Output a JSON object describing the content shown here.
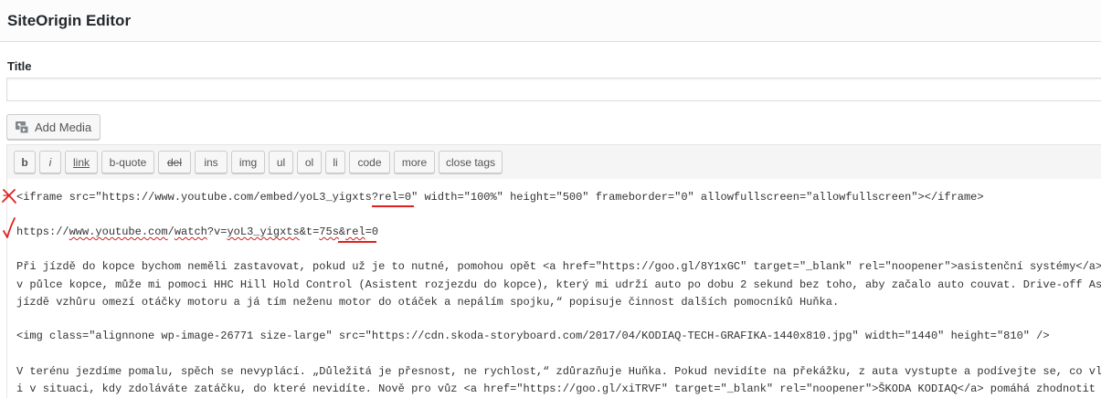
{
  "header": {
    "title": "SiteOrigin Editor"
  },
  "title_field": {
    "label": "Title",
    "value": ""
  },
  "media": {
    "label": "Add Media",
    "icon": "add-media-icon"
  },
  "toolbar": {
    "buttons": [
      "b",
      "i",
      "link",
      "b-quote",
      "del",
      "ins",
      "img",
      "ul",
      "ol",
      "li",
      "code",
      "more",
      "close tags"
    ]
  },
  "annotations": {
    "wrong_mark": "✗",
    "correct_mark": "✓",
    "mark_color": "#e02020"
  },
  "content": {
    "line1": "<iframe src=\"https://www.youtube.com/embed/yoL3_yigxts?rel=0\" width=\"100%\" height=\"500\" frameborder=\"0\" allowfullscreen=\"allowfullscreen\"></iframe>",
    "line2": {
      "p1": "https://",
      "p2": "www.youtube.com",
      "p3": "/",
      "p4": "watch",
      "p5": "?v=",
      "p6": "yoL3_yigxts",
      "p7": "&t=",
      "p8": "75s",
      "p9": "&",
      "p10": "rel",
      "p11": "=0"
    },
    "line3": "Při jízdě do kopce bychom neměli zastavovat, pokud už je to nutné, pomohou opět <a href=\"https://goo.gl/8Y1xGC\" target=\"_blank\" rel=\"noopener\">asistenční systémy</a>.",
    "line4": "v půlce kopce, může mi pomoci HHC Hill Hold Control (Asistent rozjezdu do kopce), který mi udrží auto po dobu 2 sekund bez toho, aby začalo auto couvat. Drive-off Ass",
    "line5": "jízdě vzhůru omezí otáčky motoru a já tím neženu motor do otáček a nepálím spojku,“ popisuje činnost dalších pomocníků Huňka.",
    "line6": "<img class=\"alignnone wp-image-26771 size-large\" src=\"https://cdn.skoda-storyboard.com/2017/04/KODIAQ-TECH-GRAFIKA-1440x810.jpg\" width=\"1440\" height=\"810\" />",
    "line7": "V terénu jezdíme pomalu, spěch se nevyplácí. „Důležitá je přesnost, ne rychlost,“ zdůrazňuje Huňka. Pokud nevidíte na překážku, z auta vystupte a podívejte se, co vla",
    "line8": "i v situaci, kdy zdoláváte zatáčku, do které nevidíte. Nově pro vůz <a href=\"https://goo.gl/xiTRVF\" target=\"_blank\" rel=\"noopener\">ŠKODA KODIAQ</a> pomáhá zhodnotit s"
  }
}
